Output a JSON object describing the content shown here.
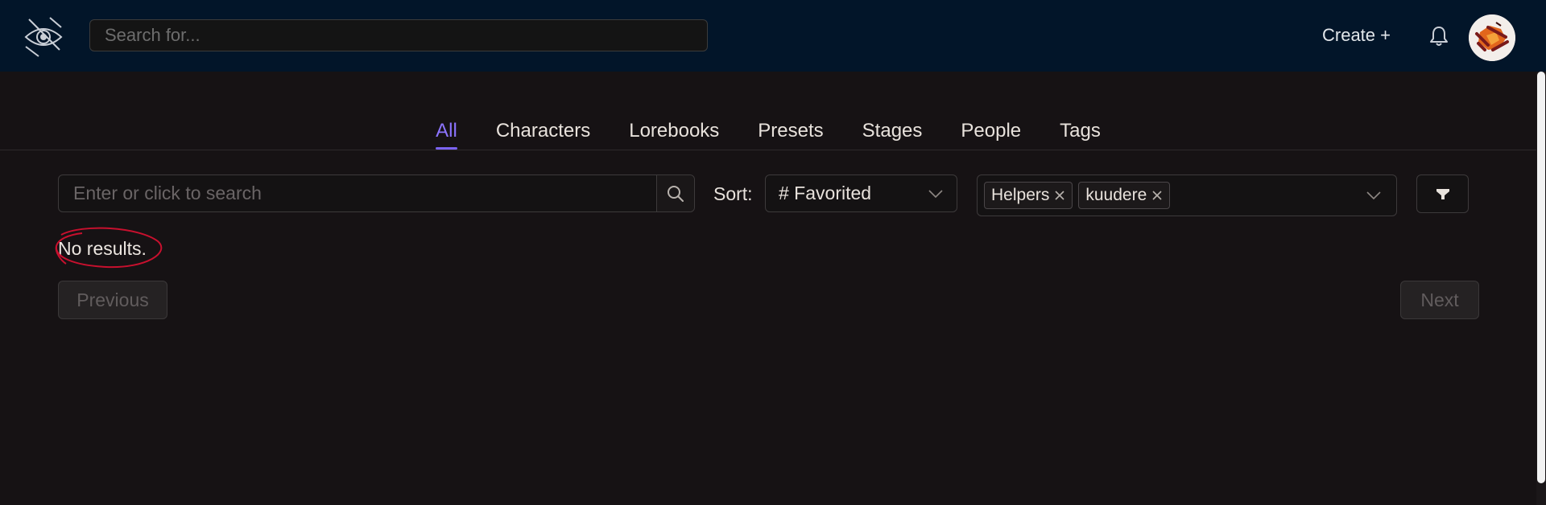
{
  "header": {
    "search_placeholder": "Search for...",
    "create_label": "Create +"
  },
  "tabs": [
    {
      "label": "All",
      "active": true
    },
    {
      "label": "Characters",
      "active": false
    },
    {
      "label": "Lorebooks",
      "active": false
    },
    {
      "label": "Presets",
      "active": false
    },
    {
      "label": "Stages",
      "active": false
    },
    {
      "label": "People",
      "active": false
    },
    {
      "label": "Tags",
      "active": false
    }
  ],
  "filters": {
    "search_placeholder": "Enter or click to search",
    "sort_label": "Sort:",
    "sort_value": "# Favorited",
    "tags": [
      "Helpers",
      "kuudere"
    ]
  },
  "results": {
    "message": "No results."
  },
  "pagination": {
    "previous_label": "Previous",
    "next_label": "Next"
  },
  "colors": {
    "header_bg": "#021529",
    "page_bg": "#161214",
    "accent": "#8c74ff",
    "annotation": "#c8102e"
  },
  "icons": {
    "logo": "eye-logo-icon",
    "bell": "bell-icon",
    "search": "search-icon",
    "filter": "filter-icon",
    "chevron": "chevron-down-icon",
    "close": "close-icon"
  }
}
